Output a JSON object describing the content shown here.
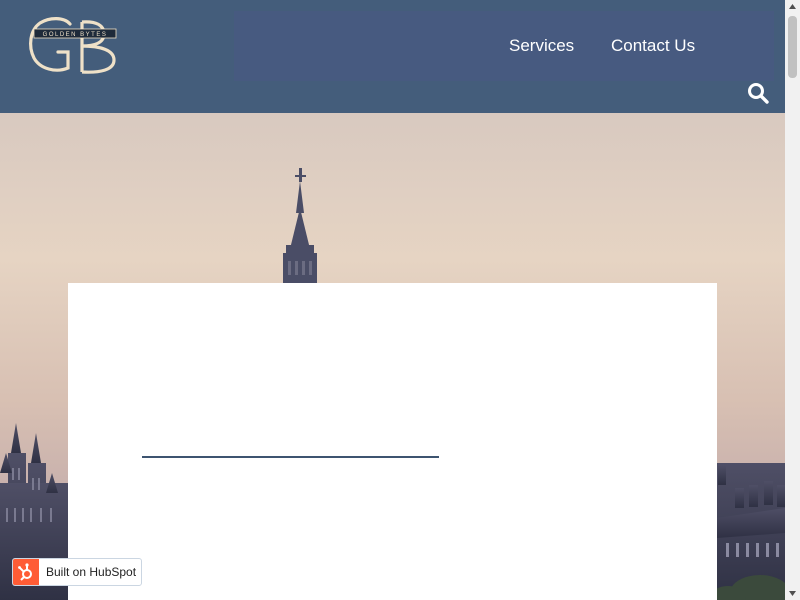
{
  "brand": {
    "logo_monogram": "GB",
    "logo_wordmark": "GOLDEN BYTES"
  },
  "nav": {
    "items": [
      {
        "label": "Services"
      },
      {
        "label": "Contact Us"
      }
    ],
    "search_icon": "search-icon"
  },
  "badge": {
    "label": "Built on HubSpot",
    "icon": "hubspot-sprocket-icon"
  },
  "colors": {
    "header_bg": "#445d7b",
    "nav_band_bg": "#475a80",
    "logo_cream": "#efe1c8",
    "card_rule": "#3d5470",
    "hubspot_orange": "#ff5c35"
  }
}
